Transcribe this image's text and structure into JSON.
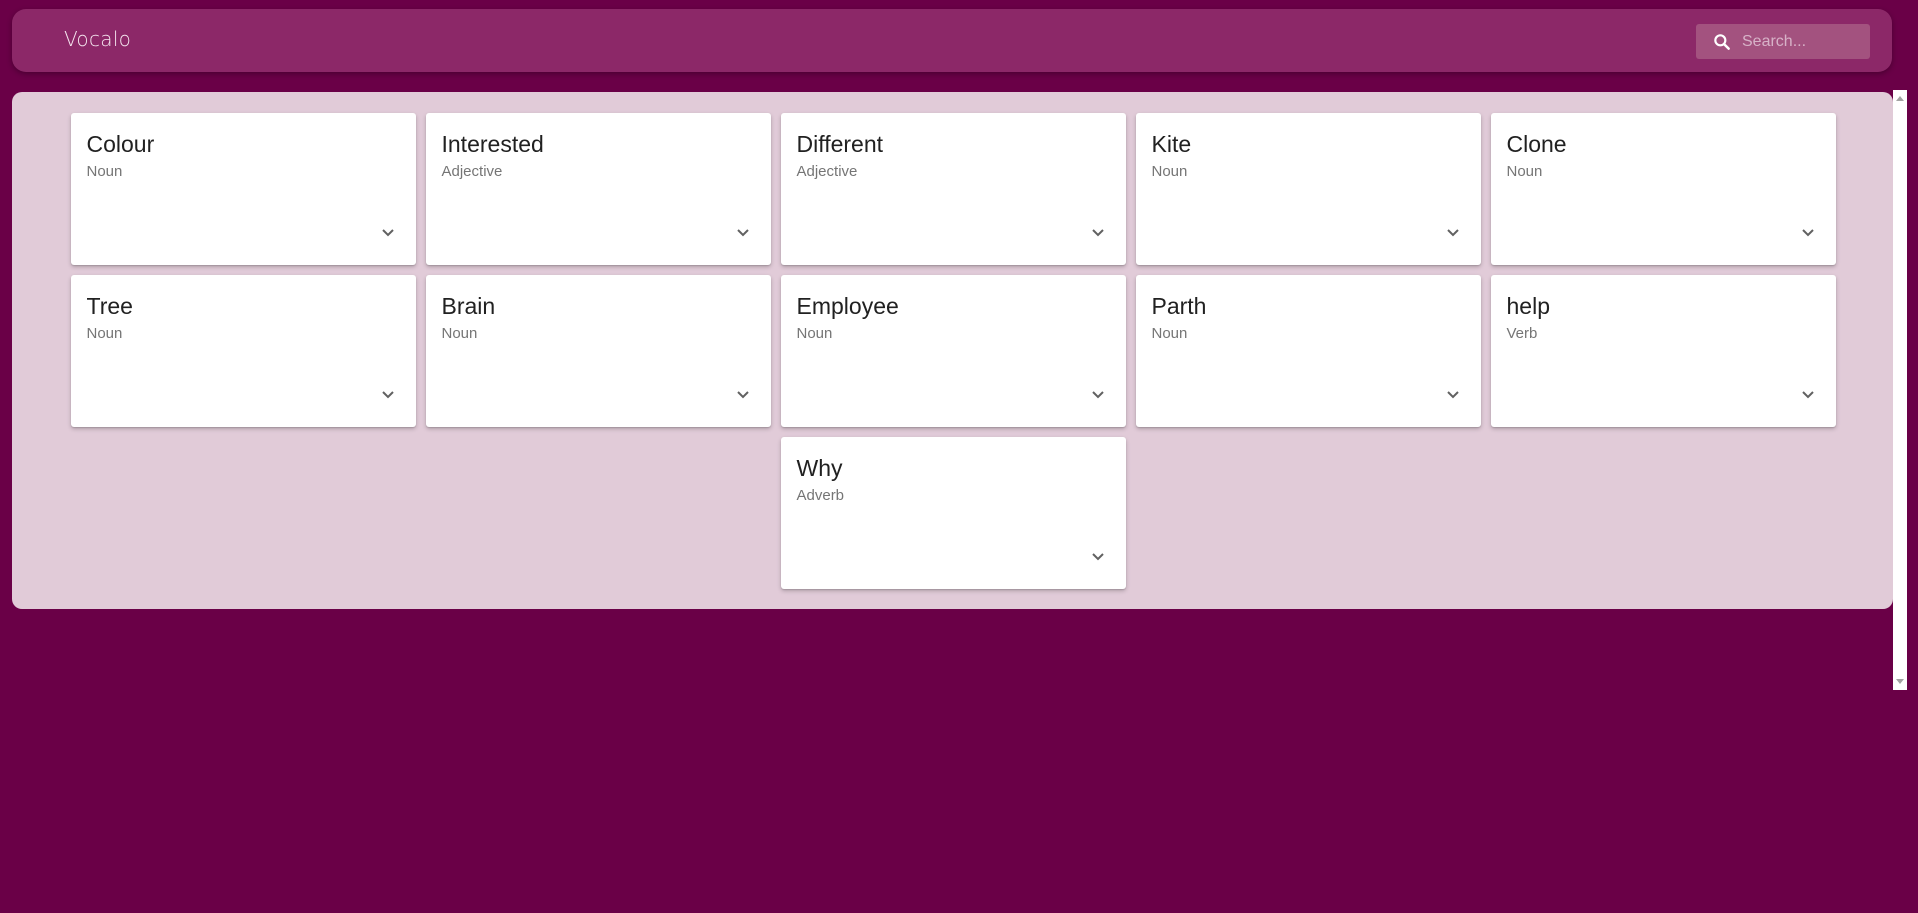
{
  "app": {
    "title": "Vocalo"
  },
  "search": {
    "placeholder": "Search..."
  },
  "colors": {
    "background": "#6a0047",
    "app_bar": "#8c2868",
    "content_panel": "#e1cbd8",
    "card": "#ffffff"
  },
  "icons": {
    "search": "search-icon",
    "expand": "chevron-down-icon"
  },
  "cards": [
    {
      "word": "Colour",
      "pos": "Noun"
    },
    {
      "word": "Interested",
      "pos": "Adjective"
    },
    {
      "word": "Different",
      "pos": "Adjective"
    },
    {
      "word": "Kite",
      "pos": "Noun"
    },
    {
      "word": "Clone",
      "pos": "Noun"
    },
    {
      "word": "Tree",
      "pos": "Noun"
    },
    {
      "word": "Brain",
      "pos": "Noun"
    },
    {
      "word": "Employee",
      "pos": "Noun"
    },
    {
      "word": "Parth",
      "pos": "Noun"
    },
    {
      "word": "help",
      "pos": "Verb"
    },
    {
      "word": "Why",
      "pos": "Adverb"
    }
  ]
}
